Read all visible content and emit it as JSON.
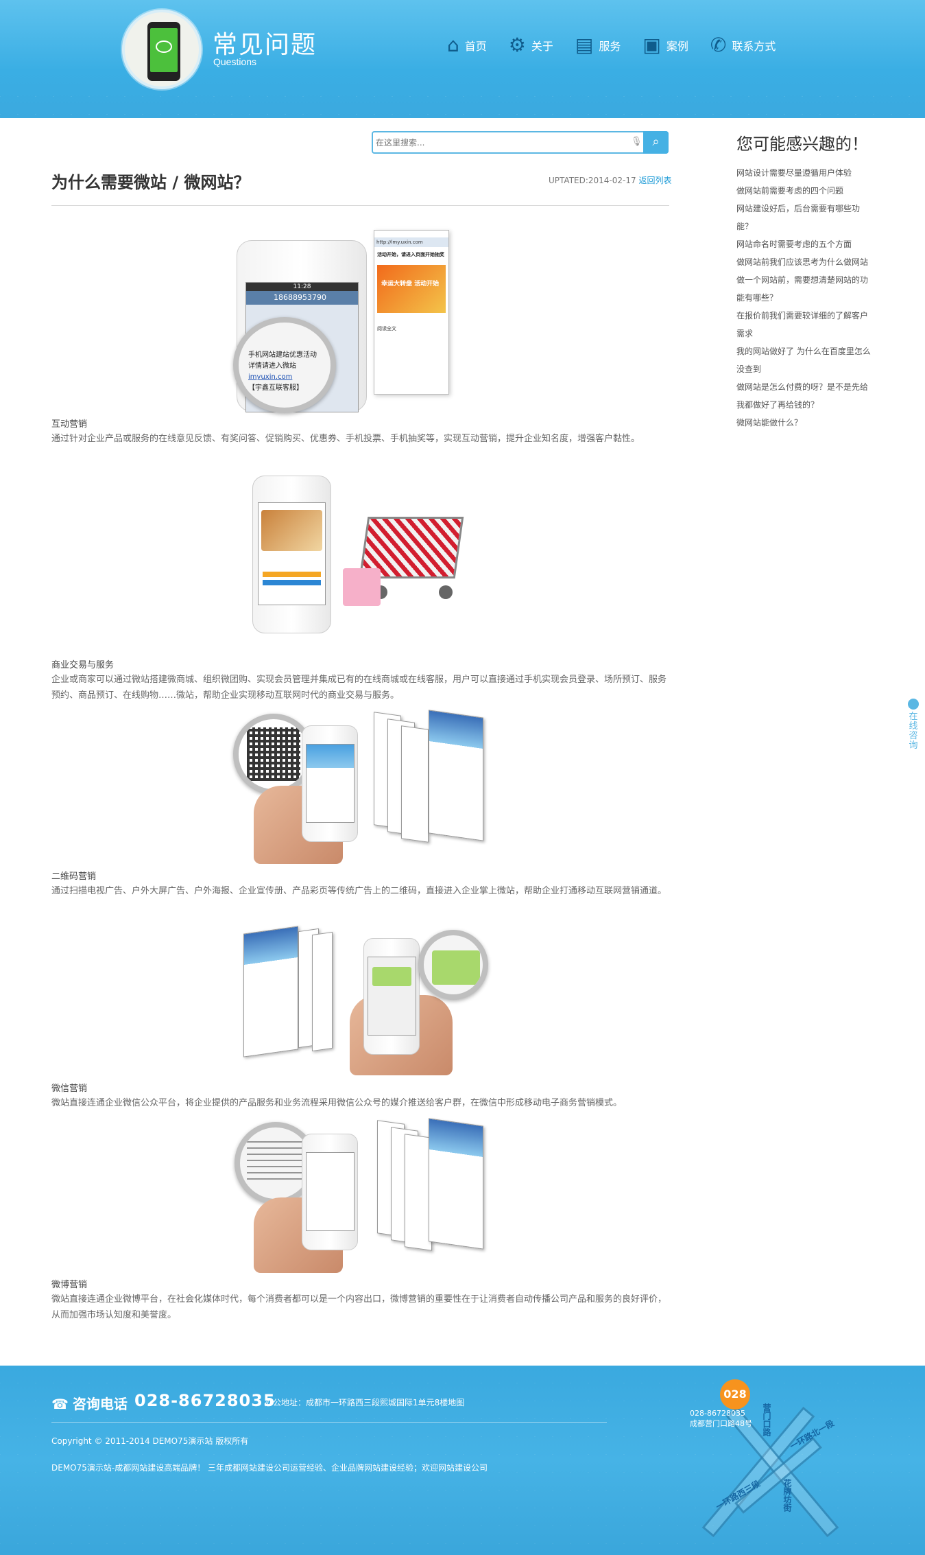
{
  "header": {
    "title": "常见问题",
    "subtitle": "Questions",
    "nav": [
      {
        "label": "首页",
        "icon": "home-icon"
      },
      {
        "label": "关于",
        "icon": "gear-icon"
      },
      {
        "label": "服务",
        "icon": "gift-icon"
      },
      {
        "label": "案例",
        "icon": "image-icon"
      },
      {
        "label": "联系方式",
        "icon": "phone-icon"
      }
    ]
  },
  "search": {
    "placeholder": "在这里搜索..."
  },
  "article": {
    "title": "为什么需要微站 / 微网站？",
    "updated": "UPTATED:2014-02-17",
    "back_link": "返回列表",
    "sections": [
      {
        "label": "互动营销",
        "text": "通过针对企业产品或服务的在线意见反馈、有奖问答、促销购买、优惠券、手机投票、手机抽奖等，实现互动营销，提升企业知名度，增强客户黏性。"
      },
      {
        "label": "商业交易与服务",
        "text": "企业或商家可以通过微站搭建微商城、组织微团购、实现会员管理并集成已有的在线商城或在线客服，用户可以直接通过手机实现会员登录、场所预订、服务预约、商品预订、在线购物……微站，帮助企业实现移动互联网时代的商业交易与服务。"
      },
      {
        "label": "二维码营销",
        "text": "通过扫描电视广告、户外大屏广告、户外海报、企业宣传册、产品彩页等传统广告上的二维码，直接进入企业掌上微站，帮助企业打通移动互联网营销通道。"
      },
      {
        "label": "微信营销",
        "text": "微站直接连通企业微信公众平台，将企业提供的产品服务和业务流程采用微信公众号的媒介推送给客户群，在微信中形成移动电子商务营销模式。"
      },
      {
        "label": "微博营销",
        "text": "微站直接连通企业微博平台，在社会化媒体时代，每个消费者都可以是一个内容出口，微博营销的重要性在于让消费者自动传播公司产品和服务的良好评价，从而加强市场认知度和美誉度。"
      }
    ],
    "figure1": {
      "phone_time": "11:28",
      "phone_number": "18688953790",
      "sms_lines": [
        "手机网站建站优惠活动",
        "详情请进入微站",
        "imyuxin.com",
        "【宇鑫互联客服】"
      ],
      "url": "http://imy.uxin.com",
      "screen_title": "活动开始，请进入页面开始抽奖",
      "banner_text": "幸运大转盘 活动开始",
      "read_more": "阅读全文"
    }
  },
  "sidebar": {
    "title": "您可能感兴趣的！",
    "items": [
      "网站设计需要尽量遵循用户体验",
      "做网站前需要考虑的四个问题",
      "网站建设好后，后台需要有哪些功能？",
      "网站命名时需要考虑的五个方面",
      "做网站前我们应该思考为什么做网站",
      "做一个网站前，需要想清楚网站的功能有哪些？",
      "在报价前我们需要较详细的了解客户需求",
      "我的网站做好了 为什么在百度里怎么没查到",
      "做网站是怎么付费的呀？是不是先给我都做好了再给钱的？",
      "微网站能做什么？"
    ],
    "consult_label": "在线咨询"
  },
  "footer": {
    "phone_label": "咨询电话",
    "phone_number": "028-86728035",
    "address": "办公地址：成都市一环路西三段熙城国际1单元8楼地图",
    "copyright": "Copyright © 2011-2014 DEMO75演示站 版权所有",
    "slogan": "DEMO75演示站-成都网站建设高端品牌！ 三年成都网站建设公司运营经验、企业品牌网站建设经验；欢迎网站建设公司",
    "map": {
      "badge": "028",
      "line1": "028-86728035",
      "line2": "成都营门口路48号",
      "labels": [
        "营门口路",
        "一环路北一段",
        "一环路西三段",
        "花牌坊街"
      ]
    }
  },
  "colors": {
    "accent": "#3aaee4",
    "link": "#1e9bd7",
    "nav_icon": "#0f5c8c",
    "badge": "#f7931e"
  }
}
